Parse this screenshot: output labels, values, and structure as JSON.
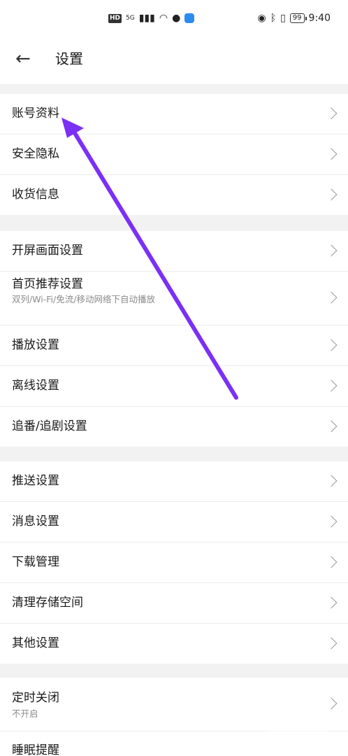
{
  "status_bar": {
    "hd": "HD",
    "network": "5G",
    "battery": "99",
    "time": "9:40"
  },
  "header": {
    "title": "设置"
  },
  "groups": [
    {
      "items": [
        {
          "label": "账号资料"
        },
        {
          "label": "安全隐私"
        },
        {
          "label": "收货信息"
        }
      ]
    },
    {
      "items": [
        {
          "label": "开屏画面设置"
        },
        {
          "label": "首页推荐设置",
          "sub": "双列/Wi-Fi/免流/移动网络下自动播放"
        },
        {
          "label": "播放设置"
        },
        {
          "label": "离线设置"
        },
        {
          "label": "追番/追剧设置"
        }
      ]
    },
    {
      "items": [
        {
          "label": "推送设置"
        },
        {
          "label": "消息设置"
        },
        {
          "label": "下载管理"
        },
        {
          "label": "清理存储空间"
        },
        {
          "label": "其他设置"
        }
      ]
    },
    {
      "items": [
        {
          "label": "定时关闭",
          "sub": "不开启"
        },
        {
          "label": "睡眠提醒"
        }
      ]
    }
  ],
  "annotation": {
    "color": "#7b2ff7"
  }
}
